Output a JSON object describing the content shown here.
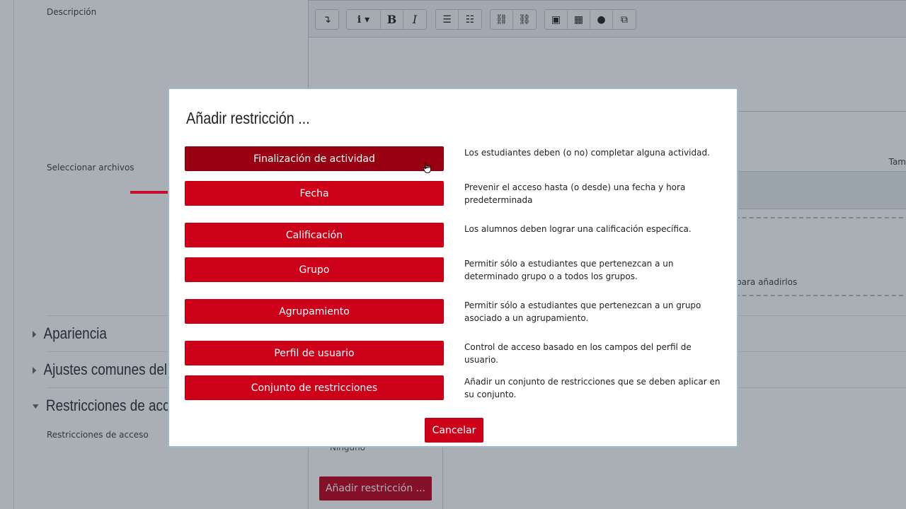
{
  "background": {
    "labels": {
      "description": "Descripción",
      "select_files": "Seleccionar archivos",
      "access_restrictions": "Restricciones de acceso"
    },
    "editor_toolbar": {
      "groups": [
        [
          {
            "icon": "collapse-icon",
            "glyph": "↴"
          }
        ],
        [
          {
            "icon": "info-dropdown-icon",
            "glyph": "i ▾"
          },
          {
            "icon": "bold-icon",
            "glyph": "B"
          },
          {
            "icon": "italic-icon",
            "glyph": "I"
          }
        ],
        [
          {
            "icon": "unordered-list-icon",
            "glyph": "☰"
          },
          {
            "icon": "ordered-list-icon",
            "glyph": "☷"
          }
        ],
        [
          {
            "icon": "link-icon",
            "glyph": "⛓"
          },
          {
            "icon": "unlink-icon",
            "glyph": "⛓"
          }
        ],
        [
          {
            "icon": "image-icon",
            "glyph": "▣"
          },
          {
            "icon": "media-icon",
            "glyph": "▦"
          },
          {
            "icon": "microphone-icon",
            "glyph": "●"
          },
          {
            "icon": "manage-files-icon",
            "glyph": "⧉"
          }
        ]
      ]
    },
    "filepicker": {
      "size_header": "Tam",
      "drop_text": "para añadirlos"
    },
    "sections": [
      {
        "title": "Apariencia",
        "expanded": false
      },
      {
        "title": "Ajustes comunes del",
        "expanded": false
      },
      {
        "title": "Restricciones de acc",
        "expanded": true
      }
    ],
    "restrictions_none": "Ninguno",
    "add_restriction_button": "Añadir restricción ..."
  },
  "modal": {
    "title": "Añadir restricción ...",
    "options": [
      {
        "label": "Finalización de actividad",
        "description": "Los estudiantes deben (o no) completar alguna actividad.",
        "active": true
      },
      {
        "label": "Fecha",
        "description": "Prevenir el acceso hasta (o desde) una fecha y hora predeterminada"
      },
      {
        "label": "Calificación",
        "description": "Los alumnos deben lograr una calificación específica."
      },
      {
        "label": "Grupo",
        "description": "Permitir sólo a estudiantes que pertenezcan a un determinado grupo o a todos los grupos."
      },
      {
        "label": "Agrupamiento",
        "description": "Permitir sólo a estudiantes que pertenezcan a un grupo asociado a un agrupamiento."
      },
      {
        "label": "Perfil de usuario",
        "description": "Control de acceso basado en los campos del perfil de usuario."
      },
      {
        "label": "Conjunto de restricciones",
        "description": "Añadir un conjunto de restricciones que se deben aplicar en su conjunto."
      }
    ],
    "cancel_label": "Cancelar"
  },
  "colors": {
    "primary_red": "#cc0019",
    "active_red": "#990012",
    "annotation_arrow": "#c8102e",
    "modal_border": "#9fb9cf"
  }
}
